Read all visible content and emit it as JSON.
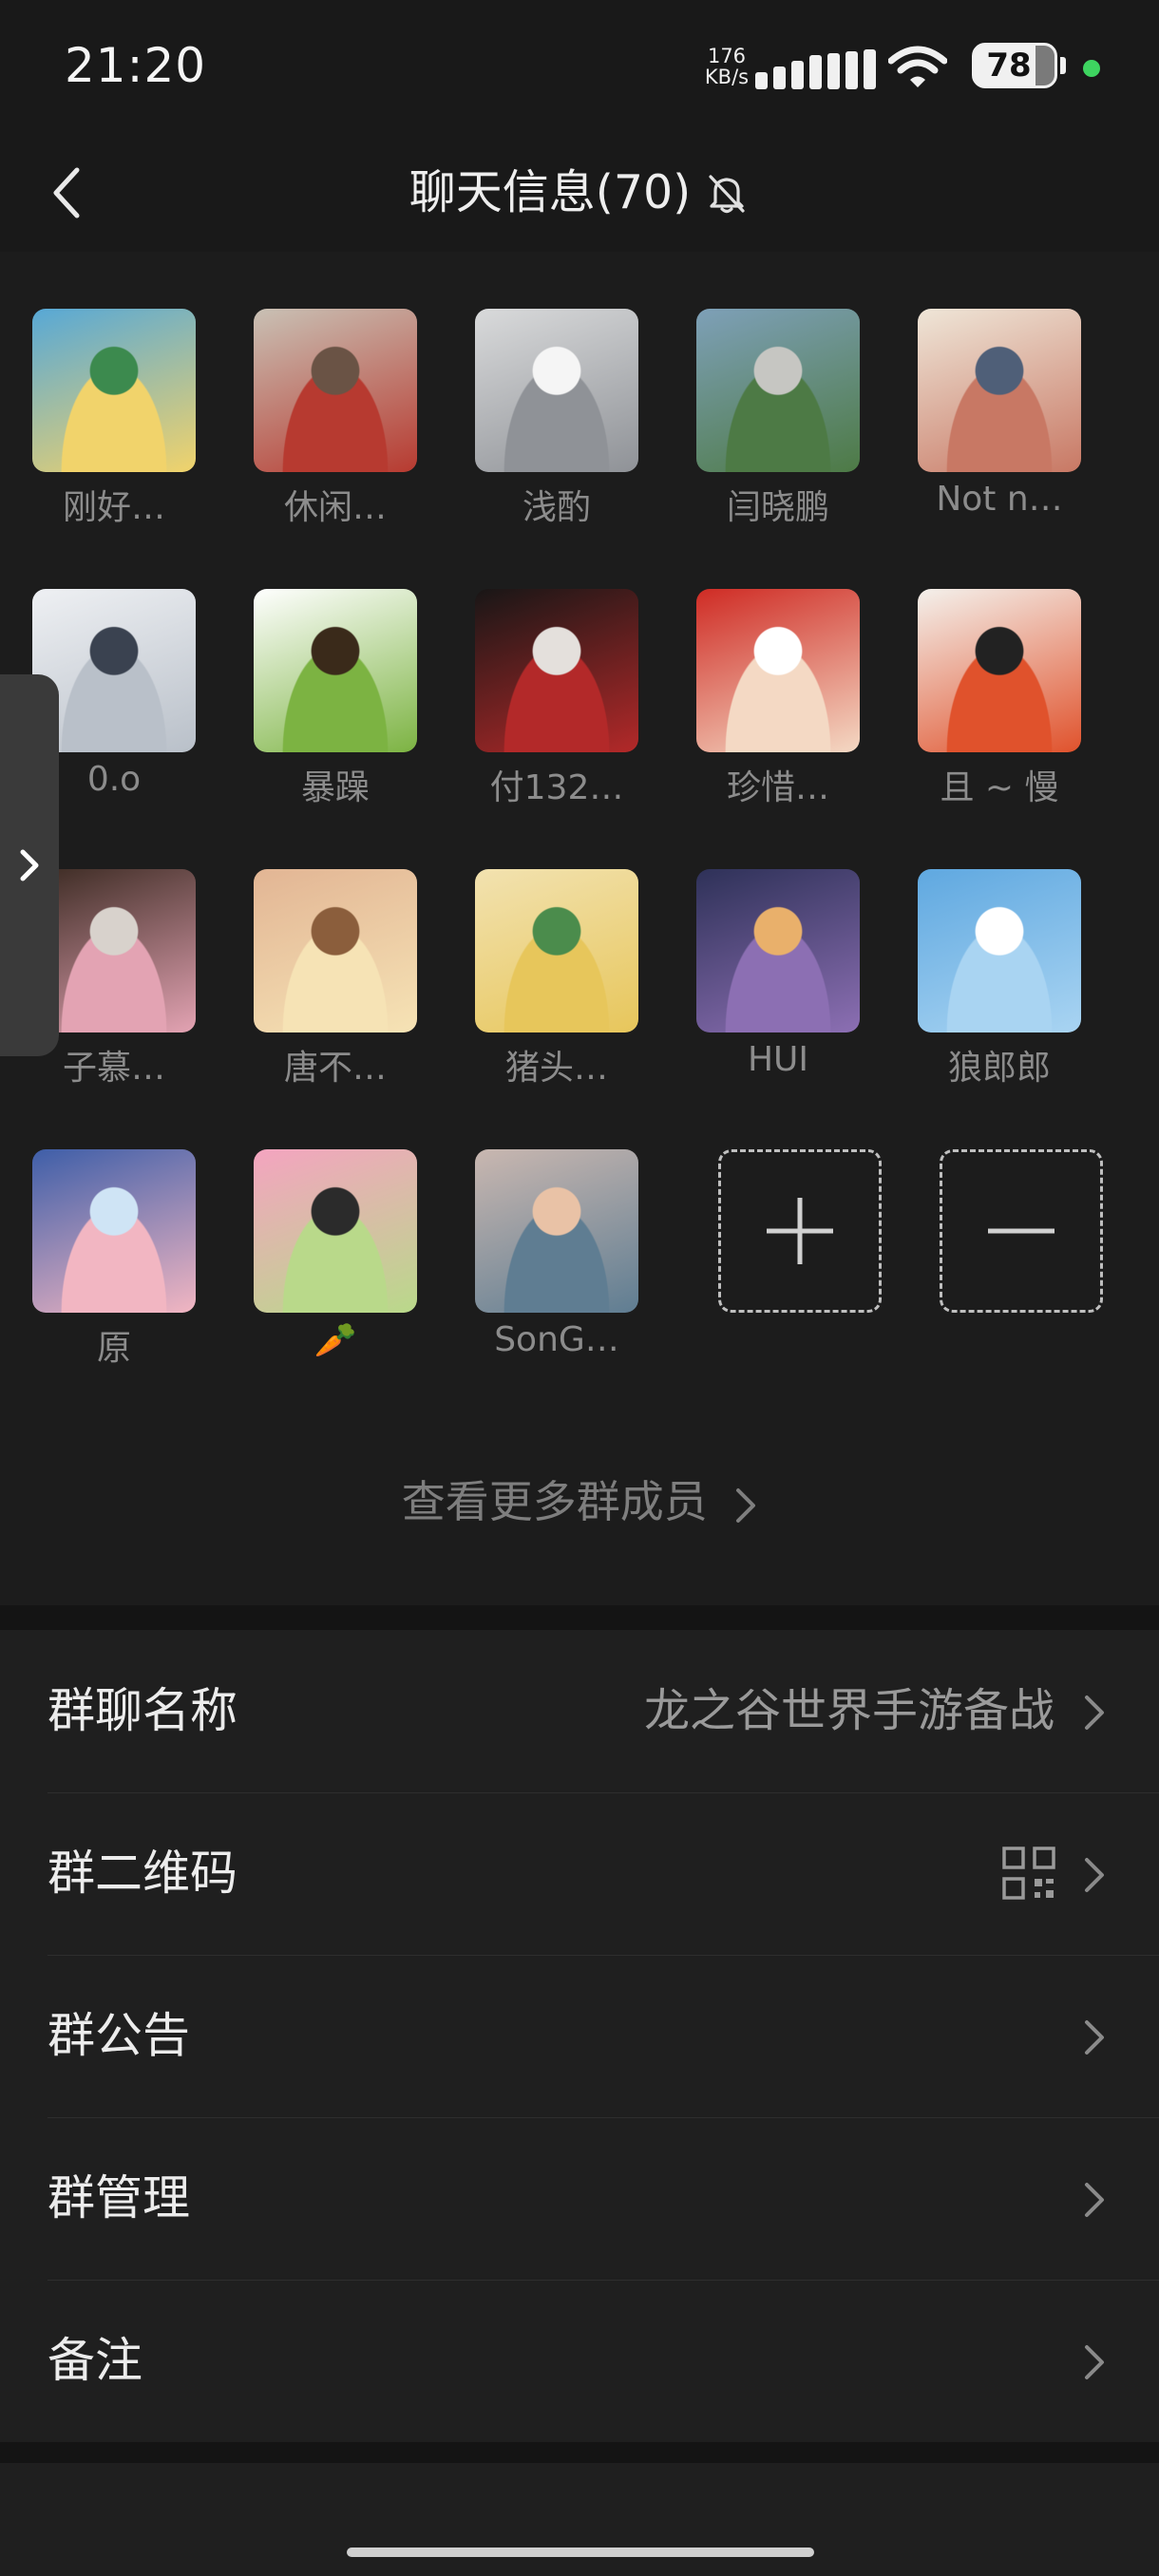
{
  "status_bar": {
    "time": "21:20",
    "net_speed_value": "176",
    "net_speed_unit": "KB/s",
    "battery_level": "78",
    "signal_icon": "signal-bars-icon",
    "wifi_icon": "wifi-icon"
  },
  "header": {
    "title": "聊天信息(70)",
    "back_icon": "back-arrow-icon",
    "mute_icon": "bell-off-icon"
  },
  "members": [
    {
      "name": "刚好…",
      "avatar_colors": [
        "#57a8d6",
        "#f1d36b",
        "#3c8a4e"
      ]
    },
    {
      "name": "休闲…",
      "avatar_colors": [
        "#c9c1b5",
        "#b73a30",
        "#6a5345"
      ]
    },
    {
      "name": "浅酌",
      "avatar_colors": [
        "#d9dadb",
        "#8f9297",
        "#f5f5f5"
      ]
    },
    {
      "name": "闫晓鹏",
      "avatar_colors": [
        "#7ea0b8",
        "#4d7a45",
        "#c6c6c2"
      ]
    },
    {
      "name": "Not  n…",
      "avatar_colors": [
        "#efe6d8",
        "#c87864",
        "#4f5f78"
      ]
    },
    {
      "name": "0.o",
      "avatar_colors": [
        "#eef0f3",
        "#b9c0c9",
        "#3a4250"
      ]
    },
    {
      "name": "暴躁",
      "avatar_colors": [
        "#ffffff",
        "#7cb342",
        "#3a2a1a"
      ]
    },
    {
      "name": "付132…",
      "avatar_colors": [
        "#181616",
        "#b32929",
        "#e4e0dc"
      ]
    },
    {
      "name": "珍惜…",
      "avatar_colors": [
        "#cf2b24",
        "#f4d9c4",
        "#ffffff"
      ]
    },
    {
      "name": "且 ~ 慢",
      "avatar_colors": [
        "#f4f1ec",
        "#e0522c",
        "#222222"
      ]
    },
    {
      "name": "子慕…",
      "avatar_colors": [
        "#3b2a22",
        "#e3a3b3",
        "#d8d2cc"
      ]
    },
    {
      "name": "唐不…",
      "avatar_colors": [
        "#e2b594",
        "#f6e3b5",
        "#8b5e3c"
      ]
    },
    {
      "name": "猪头…",
      "avatar_colors": [
        "#f2e2b0",
        "#e7c65b",
        "#4b8c4c"
      ]
    },
    {
      "name": "HUI",
      "avatar_colors": [
        "#2e3158",
        "#8c6fb3",
        "#e9b06b"
      ]
    },
    {
      "name": "狼郎郎",
      "avatar_colors": [
        "#5fa8e0",
        "#a9d4f2",
        "#ffffff"
      ]
    },
    {
      "name": "原",
      "avatar_colors": [
        "#3e5ea8",
        "#f2b6c2",
        "#cfe4f5"
      ]
    },
    {
      "name": "🥕",
      "avatar_colors": [
        "#f4a4c0",
        "#b9d98a",
        "#2b2b2b"
      ]
    },
    {
      "name": "SonG…",
      "avatar_colors": [
        "#c9b7b0",
        "#5f7d92",
        "#e9c2a6"
      ]
    }
  ],
  "member_actions": {
    "add_icon": "plus-icon",
    "remove_icon": "minus-icon"
  },
  "see_more": {
    "label": "查看更多群成员"
  },
  "settings": [
    {
      "label": "群聊名称",
      "value": "龙之谷世界手游备战"
    },
    {
      "label": "群二维码",
      "value": "",
      "icon": "qr-code-icon"
    },
    {
      "label": "群公告",
      "value": ""
    },
    {
      "label": "群管理",
      "value": ""
    },
    {
      "label": "备注",
      "value": ""
    }
  ]
}
